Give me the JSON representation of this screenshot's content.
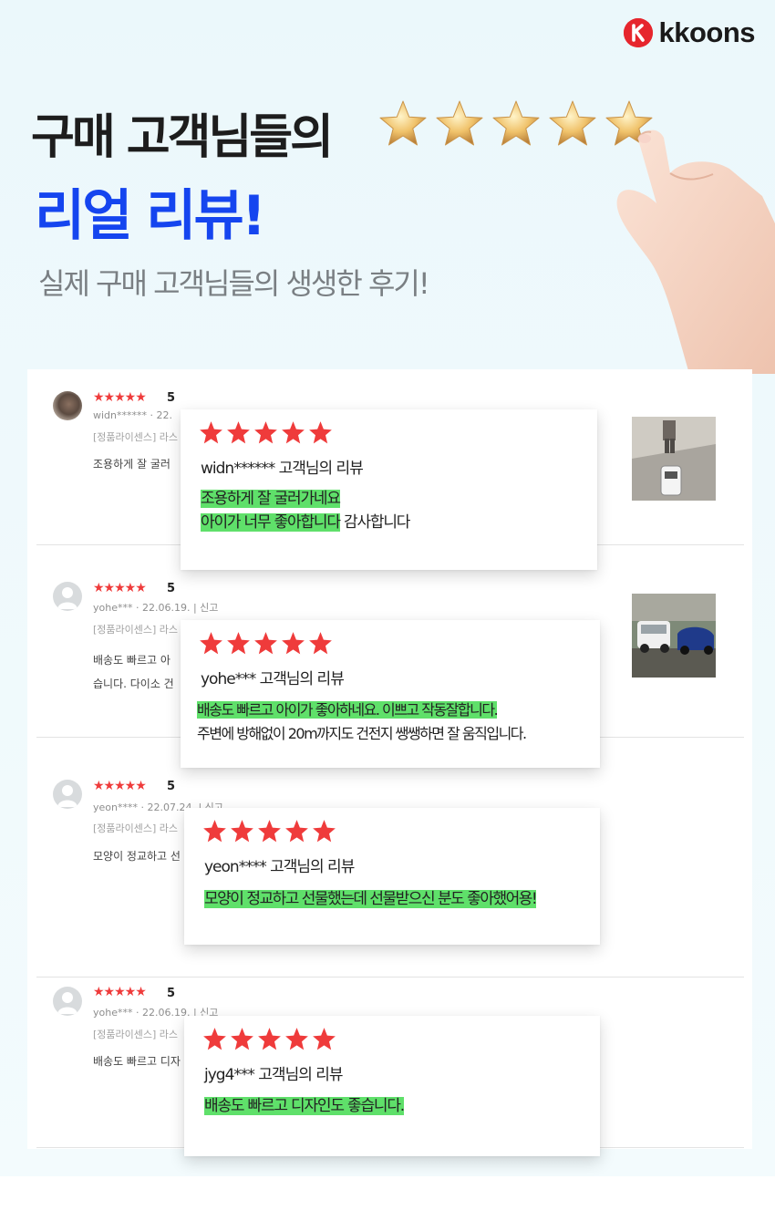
{
  "brand": {
    "name": "kkoons",
    "mark_letter": "K",
    "mark_color": "#e6262d"
  },
  "hero": {
    "title_line1": "구매 고객님들의",
    "title_line2": "리얼 리뷰!",
    "subtitle": "실제 구매 고객님들의 생생한 후기!",
    "title_accent_color": "#1545ef",
    "gold_star_count": 5
  },
  "star_glyphs": "★★★★★",
  "reviews": [
    {
      "score": "5",
      "meta": "widn****** · 22.",
      "badge": "[정품라이센스] 라스",
      "snippet_lines": [
        "조용하게 잘 굴러"
      ],
      "has_photo": true,
      "card": {
        "name_line": "widn******  고객님의 리뷰",
        "line1_highlight": "조용하게 잘 굴러가네요",
        "line2_highlight": "아이가 너무 좋아합니다",
        "line2_rest": " 감사합니다"
      }
    },
    {
      "score": "5",
      "meta": "yohe*** · 22.06.19.  |  신고",
      "badge": "[정품라이센스] 라스",
      "snippet_lines": [
        "배송도 빠르고 아",
        "습니다. 다이소 건"
      ],
      "has_photo": true,
      "card": {
        "name_line": "yohe***  고객님의 리뷰",
        "line1_highlight": "배송도 빠르고 아이가 좋아하네요. 이쁘고 작동잘합니다.",
        "line2_plain": "주변에 방해없이 20m까지도 건전지 쌩쌩하면 잘 움직입니다."
      }
    },
    {
      "score": "5",
      "meta": "yeon**** · 22.07.24.  |  신고",
      "badge": "[정품라이센스] 라스",
      "snippet_lines": [
        "모양이 정교하고 선"
      ],
      "has_photo": false,
      "card": {
        "name_line": "yeon**** 고객님의 리뷰",
        "line1_highlight": "모양이 정교하고 선물했는데 선물받으신 분도 좋아했어용!"
      }
    },
    {
      "score": "5",
      "meta": "yohe*** · 22.06.19.  |  신고",
      "badge": "[정품라이센스] 라스",
      "snippet_lines": [
        "배송도 빠르고 디자"
      ],
      "has_photo": false,
      "card": {
        "name_line": "jyg4***  고객님의 리뷰",
        "line1_highlight": "배송도 빠르고 디자인도 좋습니다."
      }
    }
  ],
  "colors": {
    "star_red": "#ef3b3b",
    "highlight_green": "#5fe06a",
    "gold_star": "#e8b65a"
  }
}
